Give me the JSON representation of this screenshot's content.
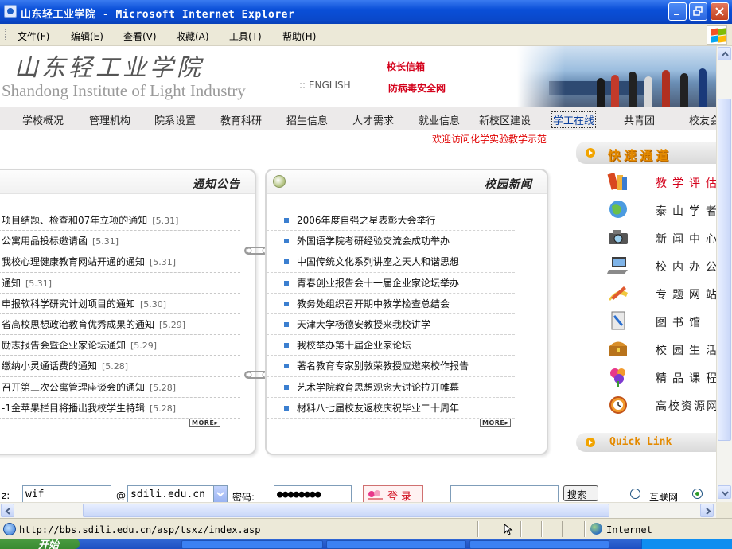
{
  "window": {
    "title": "山东轻工业学院 - Microsoft Internet Explorer"
  },
  "menu": {
    "items": [
      {
        "label": "文件(F)"
      },
      {
        "label": "编辑(E)"
      },
      {
        "label": "查看(V)"
      },
      {
        "label": "收藏(A)"
      },
      {
        "label": "工具(T)"
      },
      {
        "label": "帮助(H)"
      }
    ]
  },
  "banner": {
    "calligraphy": "山东轻工业学院",
    "english_name": "Shandong Institute of Light Industry",
    "english_link": ":: ENGLISH",
    "president_mailbox": "校长信箱",
    "anti_drug_net": "防病毒安全网"
  },
  "nav": {
    "items": [
      {
        "label": "学校概况"
      },
      {
        "label": "管理机构"
      },
      {
        "label": "院系设置"
      },
      {
        "label": "教育科研"
      },
      {
        "label": "招生信息"
      },
      {
        "label": "人才需求"
      },
      {
        "label": "就业信息"
      },
      {
        "label": "新校区建设"
      },
      {
        "label": "学工在线"
      },
      {
        "label": "共青团"
      },
      {
        "label": "校友会"
      }
    ]
  },
  "welcome_marquee": "欢迎访问化学实验教学示范",
  "notices": {
    "title": "通知公告",
    "items": [
      {
        "text": "项目结题、检查和07年立项的通知",
        "date": "[5.31]"
      },
      {
        "text": "公寓用品投标邀请函",
        "date": "[5.31]"
      },
      {
        "text": "我校心理健康教育网站开通的通知",
        "date": "[5.31]"
      },
      {
        "text": "通知",
        "date": "[5.31]"
      },
      {
        "text": "申报软科学研究计划项目的通知",
        "date": "[5.30]"
      },
      {
        "text": "省高校思想政治教育优秀成果的通知",
        "date": "[5.29]"
      },
      {
        "text": "励志报告会暨企业家论坛通知",
        "date": "[5.29]"
      },
      {
        "text": "缴纳小灵通话费的通知",
        "date": "[5.28]"
      },
      {
        "text": "召开第三次公寓管理座谈会的通知",
        "date": "[5.28]"
      },
      {
        "text": "-1金苹果栏目将播出我校学生特辑",
        "date": "[5.28]"
      }
    ],
    "more": "MORE▸"
  },
  "news": {
    "title": "校园新闻",
    "items": [
      {
        "text": "2006年度自强之星表彰大会举行"
      },
      {
        "text": "外国语学院考研经验交流会成功举办"
      },
      {
        "text": "中国传统文化系列讲座之天人和谐思想"
      },
      {
        "text": "青春创业报告会十一届企业家论坛举办"
      },
      {
        "text": "教务处组织召开期中教学检查总结会"
      },
      {
        "text": "天津大学杨德安教授来我校讲学"
      },
      {
        "text": "我校举办第十届企业家论坛"
      },
      {
        "text": "著名教育专家别敦荣教授应邀来校作报告"
      },
      {
        "text": "艺术学院教育思想观念大讨论拉开帷幕"
      },
      {
        "text": "材料八七届校友返校庆祝毕业二十周年"
      }
    ],
    "more": "MORE▸"
  },
  "quick": {
    "title": "快速通道",
    "items": [
      {
        "label": "教学评估",
        "color": "#d4001a",
        "icon": "books-icon"
      },
      {
        "label": "泰山学者",
        "color": "#222222",
        "icon": "globe-icon"
      },
      {
        "label": "新闻中心",
        "color": "#222222",
        "icon": "camera-icon"
      },
      {
        "label": "校内办公",
        "color": "#222222",
        "icon": "laptop-icon"
      },
      {
        "label": "专题网站",
        "color": "#222222",
        "icon": "pen-icon"
      },
      {
        "label": "图书馆",
        "color": "#222222",
        "icon": "scanner-icon"
      },
      {
        "label": "校园生活",
        "color": "#222222",
        "icon": "treasure-icon"
      },
      {
        "label": "精品课程",
        "color": "#222222",
        "icon": "flower-icon"
      },
      {
        "label": "高校资源网",
        "color": "#222222",
        "icon": "clock-icon"
      }
    ],
    "link_title": "Quick Link"
  },
  "login": {
    "user_label": "z:",
    "user_value": "wif",
    "at": "@",
    "domain_value": "sdili.edu.cn",
    "password_label": "密码:",
    "password_value": "●●●●●●●●",
    "login_button": "登录",
    "search_button": "搜索",
    "radio_internet": "互联网"
  },
  "status": {
    "url": "http://bbs.sdili.edu.cn/asp/tsxz/index.asp",
    "zone": "Internet"
  },
  "taskbar": {
    "start": "开始"
  }
}
